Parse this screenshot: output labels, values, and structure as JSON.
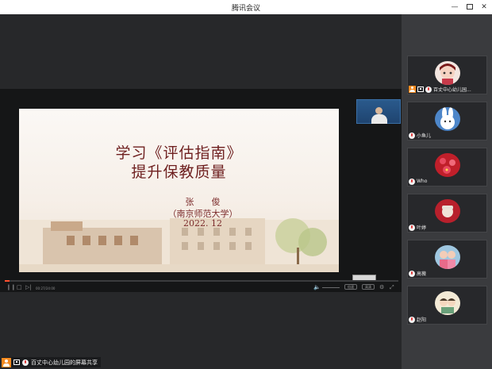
{
  "window": {
    "title": "腾讯会议",
    "min_glyph": "—",
    "close_glyph": "✕"
  },
  "slide": {
    "title_line1": "学习《评估指南》",
    "title_line2": "提升保教质量",
    "author": "张　　俊",
    "affiliation": "（南京师范大学）",
    "date": "2022. 12"
  },
  "player": {
    "progress": 0.012,
    "time": "00:27/24:00",
    "btn_a": "倍速",
    "btn_b": "高清",
    "glyph_pause": "❙❙",
    "glyph_stop": "□",
    "glyph_next": "▷|",
    "glyph_volume": "🔈",
    "glyph_settings": "⚙",
    "glyph_fullscreen": "⤢"
  },
  "participants": [
    {
      "name": "百丈中心幼儿园...",
      "host": true,
      "sharing": true,
      "avatar": "cartoon-girl",
      "color": "#7a1a1a"
    },
    {
      "name": "小鱼儿",
      "host": false,
      "sharing": false,
      "avatar": "rabbit",
      "color": "#4d86c9"
    },
    {
      "name": "Who",
      "host": false,
      "sharing": false,
      "avatar": "red-flowers",
      "color": "#c01f2a"
    },
    {
      "name": "叶婷",
      "host": false,
      "sharing": false,
      "avatar": "red-hat",
      "color": "#b8202c"
    },
    {
      "name": "高薇",
      "host": false,
      "sharing": false,
      "avatar": "girls-photo",
      "color": "#cf4f6f"
    },
    {
      "name": "赵阳",
      "host": false,
      "sharing": false,
      "avatar": "cartoon-family",
      "color": "#e9d9b8"
    }
  ],
  "status": {
    "text": "百丈中心幼儿园的屏幕共享"
  }
}
